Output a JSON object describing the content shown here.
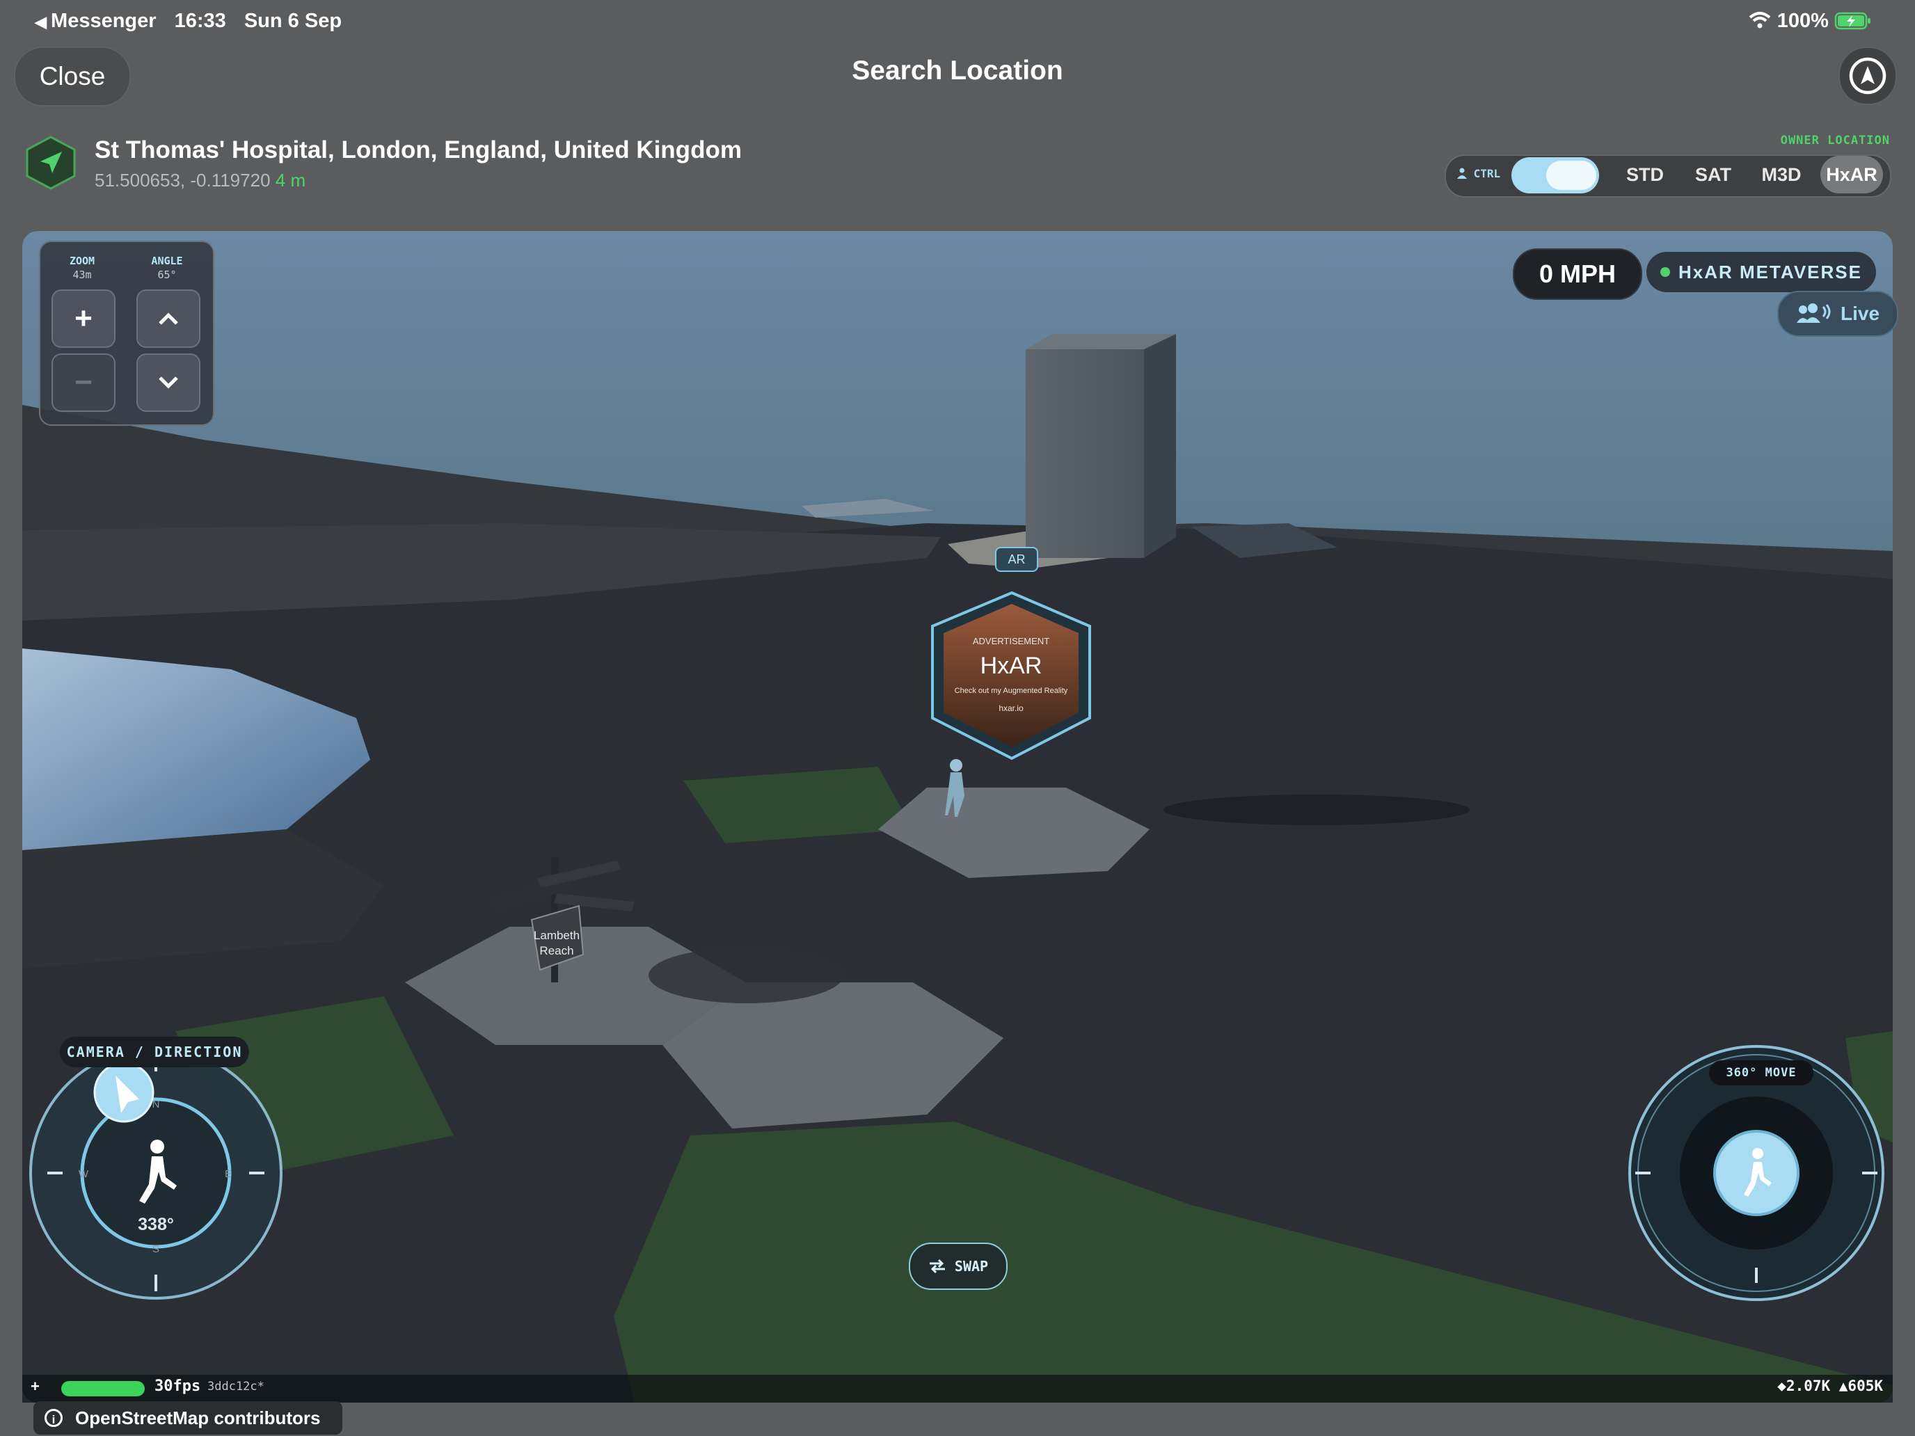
{
  "status_bar": {
    "back_app": "Messenger",
    "time": "16:33",
    "date": "Sun 6 Sep",
    "battery": "100%"
  },
  "header": {
    "close_label": "Close",
    "title": "Search Location"
  },
  "location": {
    "name": "St Thomas' Hospital, London, England, United Kingdom",
    "coords": "51.500653, -0.119720",
    "accuracy": "4 m"
  },
  "owner_label": "OWNER LOCATION",
  "mode_bar": {
    "ctrl_label": "CTRL",
    "modes": [
      "STD",
      "SAT",
      "M3D",
      "HxAR"
    ],
    "active": "HxAR"
  },
  "controls": {
    "zoom_label": "ZOOM",
    "zoom_value": "43m",
    "angle_label": "ANGLE",
    "angle_value": "65°",
    "zoom_in": "+",
    "zoom_out": "−"
  },
  "hud": {
    "speed": "0 MPH",
    "metaverse": "HxAR METAVERSE",
    "live": "Live",
    "ar_tag": "AR"
  },
  "ad": {
    "heading": "ADVERTISEMENT",
    "brand": "HxAR",
    "tagline": "Check out my Augmented Reality",
    "url": "hxar.io"
  },
  "sign": {
    "text1": "Lambeth",
    "text2": "Reach"
  },
  "camera": {
    "label": "CAMERA / DIRECTION",
    "heading_deg": "338°",
    "compass": [
      "N",
      "E",
      "S",
      "W"
    ]
  },
  "move": {
    "label": "360° MOVE"
  },
  "swap_label": "SWAP",
  "footer": {
    "plus": "+",
    "fps": "30fps",
    "build": "3ddc12c*",
    "stats": "◆2.07K ▲605K",
    "attribution": "OpenStreetMap contributors"
  },
  "colors": {
    "accent": "#a9dbf2",
    "green": "#4fd36a",
    "chrome": "#5a5c5e"
  }
}
